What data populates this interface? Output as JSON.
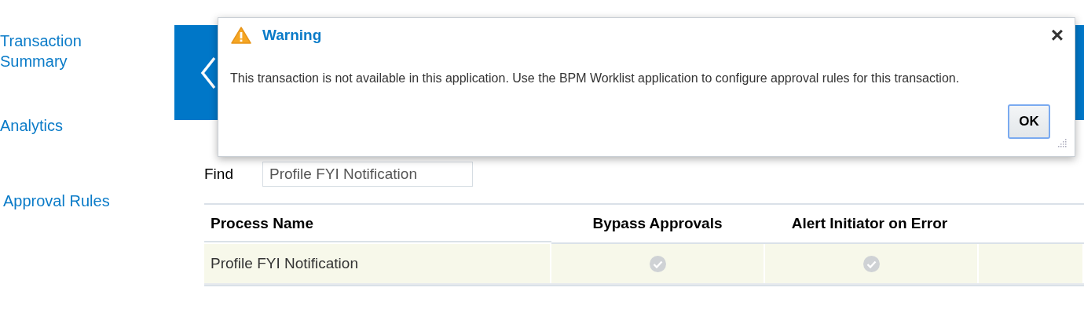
{
  "sidebar": {
    "items": [
      {
        "label": "Transaction Summary"
      },
      {
        "label": "Analytics"
      },
      {
        "label": "Approval Rules"
      }
    ]
  },
  "find": {
    "label": "Find",
    "value": "Profile FYI Notification"
  },
  "table": {
    "columns": [
      "Process Name",
      "Bypass Approvals",
      "Alert Initiator on Error"
    ],
    "rows": [
      {
        "process_name": "Profile FYI Notification",
        "bypass_approvals": true,
        "alert_initiator_on_error": true,
        "selected": true
      }
    ]
  },
  "dialog": {
    "title": "Warning",
    "close": "×",
    "message": "This transaction is not available in this application. Use the BPM Worklist application to configure approval rules for this transaction.",
    "buttons": [
      "OK"
    ]
  }
}
